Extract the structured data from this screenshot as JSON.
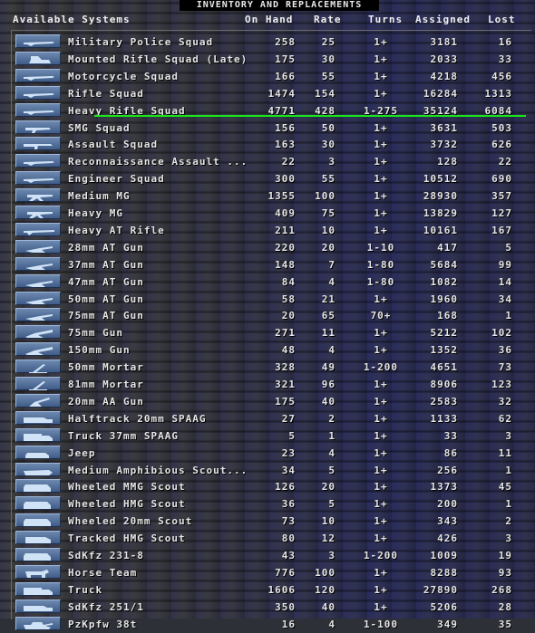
{
  "title": "INVENTORY AND REPLACEMENTS",
  "columns": {
    "name": "Available Systems",
    "on_hand": "On Hand",
    "rate": "Rate",
    "turns": "Turns",
    "assigned": "Assigned",
    "lost": "Lost"
  },
  "accent_colors": {
    "selection_line": "#18e818",
    "button": "#4f6d98"
  },
  "rows": [
    {
      "name": "Military Police Squad",
      "on_hand": "258",
      "rate": "25",
      "turns": "1+",
      "assigned": "3181",
      "lost": "16",
      "icon": "rifle-icon"
    },
    {
      "name": "Mounted Rifle Squad (Late)",
      "on_hand": "175",
      "rate": "30",
      "turns": "1+",
      "assigned": "2033",
      "lost": "33",
      "icon": "mounted-rifle-icon"
    },
    {
      "name": "Motorcycle Squad",
      "on_hand": "166",
      "rate": "55",
      "turns": "1+",
      "assigned": "4218",
      "lost": "456",
      "icon": "rifle-icon"
    },
    {
      "name": "Rifle Squad",
      "on_hand": "1474",
      "rate": "154",
      "turns": "1+",
      "assigned": "16284",
      "lost": "1313",
      "icon": "rifle-icon"
    },
    {
      "name": "Heavy Rifle Squad",
      "on_hand": "4771",
      "rate": "428",
      "turns": "1-275",
      "assigned": "35124",
      "lost": "6084",
      "icon": "rifle-icon"
    },
    {
      "name": "SMG Squad",
      "on_hand": "156",
      "rate": "50",
      "turns": "1+",
      "assigned": "3631",
      "lost": "503",
      "icon": "smg-icon"
    },
    {
      "name": "Assault Squad",
      "on_hand": "163",
      "rate": "30",
      "turns": "1+",
      "assigned": "3732",
      "lost": "626",
      "icon": "assault-rifle-icon"
    },
    {
      "name": "Reconnaissance Assault ...",
      "on_hand": "22",
      "rate": "3",
      "turns": "1+",
      "assigned": "128",
      "lost": "22",
      "icon": "rifle-icon"
    },
    {
      "name": "Engineer Squad",
      "on_hand": "300",
      "rate": "55",
      "turns": "1+",
      "assigned": "10512",
      "lost": "690",
      "icon": "rifle-icon"
    },
    {
      "name": "Medium MG",
      "on_hand": "1355",
      "rate": "100",
      "turns": "1+",
      "assigned": "28930",
      "lost": "357",
      "icon": "machine-gun-icon"
    },
    {
      "name": "Heavy MG",
      "on_hand": "409",
      "rate": "75",
      "turns": "1+",
      "assigned": "13829",
      "lost": "127",
      "icon": "machine-gun-icon"
    },
    {
      "name": "Heavy AT Rifle",
      "on_hand": "211",
      "rate": "10",
      "turns": "1+",
      "assigned": "10161",
      "lost": "167",
      "icon": "at-rifle-icon"
    },
    {
      "name": "28mm AT Gun",
      "on_hand": "220",
      "rate": "20",
      "turns": "1-10",
      "assigned": "417",
      "lost": "5",
      "icon": "at-gun-icon"
    },
    {
      "name": "37mm AT Gun",
      "on_hand": "148",
      "rate": "7",
      "turns": "1-80",
      "assigned": "5684",
      "lost": "99",
      "icon": "at-gun-icon"
    },
    {
      "name": "47mm AT Gun",
      "on_hand": "84",
      "rate": "4",
      "turns": "1-80",
      "assigned": "1082",
      "lost": "14",
      "icon": "at-gun-icon"
    },
    {
      "name": "50mm AT Gun",
      "on_hand": "58",
      "rate": "21",
      "turns": "1+",
      "assigned": "1960",
      "lost": "34",
      "icon": "at-gun-icon"
    },
    {
      "name": "75mm AT Gun",
      "on_hand": "20",
      "rate": "65",
      "turns": "70+",
      "assigned": "168",
      "lost": "1",
      "icon": "at-gun-icon"
    },
    {
      "name": "75mm Gun",
      "on_hand": "271",
      "rate": "11",
      "turns": "1+",
      "assigned": "5212",
      "lost": "102",
      "icon": "field-gun-icon"
    },
    {
      "name": "150mm Gun",
      "on_hand": "48",
      "rate": "4",
      "turns": "1+",
      "assigned": "1352",
      "lost": "36",
      "icon": "field-gun-icon"
    },
    {
      "name": "50mm Mortar",
      "on_hand": "328",
      "rate": "49",
      "turns": "1-200",
      "assigned": "4651",
      "lost": "73",
      "icon": "mortar-icon"
    },
    {
      "name": "81mm Mortar",
      "on_hand": "321",
      "rate": "96",
      "turns": "1+",
      "assigned": "8906",
      "lost": "123",
      "icon": "mortar-icon"
    },
    {
      "name": "20mm AA Gun",
      "on_hand": "175",
      "rate": "40",
      "turns": "1+",
      "assigned": "2583",
      "lost": "32",
      "icon": "aa-gun-icon"
    },
    {
      "name": "Halftrack 20mm SPAAG",
      "on_hand": "27",
      "rate": "2",
      "turns": "1+",
      "assigned": "1133",
      "lost": "62",
      "icon": "halftrack-icon"
    },
    {
      "name": "Truck 37mm SPAAG",
      "on_hand": "5",
      "rate": "1",
      "turns": "1+",
      "assigned": "33",
      "lost": "3",
      "icon": "truck-icon"
    },
    {
      "name": "Jeep",
      "on_hand": "23",
      "rate": "4",
      "turns": "1+",
      "assigned": "86",
      "lost": "11",
      "icon": "jeep-icon"
    },
    {
      "name": "Medium Amphibious Scout...",
      "on_hand": "34",
      "rate": "5",
      "turns": "1+",
      "assigned": "256",
      "lost": "1",
      "icon": "amphibious-icon"
    },
    {
      "name": "Wheeled MMG Scout",
      "on_hand": "126",
      "rate": "20",
      "turns": "1+",
      "assigned": "1373",
      "lost": "45",
      "icon": "armored-car-icon"
    },
    {
      "name": "Wheeled HMG Scout",
      "on_hand": "36",
      "rate": "5",
      "turns": "1+",
      "assigned": "200",
      "lost": "1",
      "icon": "armored-car-icon"
    },
    {
      "name": "Wheeled 20mm Scout",
      "on_hand": "73",
      "rate": "10",
      "turns": "1+",
      "assigned": "343",
      "lost": "2",
      "icon": "armored-car-icon"
    },
    {
      "name": "Tracked HMG Scout",
      "on_hand": "80",
      "rate": "12",
      "turns": "1+",
      "assigned": "426",
      "lost": "3",
      "icon": "tracked-scout-icon"
    },
    {
      "name": "SdKfz 231-8",
      "on_hand": "43",
      "rate": "3",
      "turns": "1-200",
      "assigned": "1009",
      "lost": "19",
      "icon": "armored-car-icon"
    },
    {
      "name": "Horse Team",
      "on_hand": "776",
      "rate": "100",
      "turns": "1+",
      "assigned": "8288",
      "lost": "93",
      "icon": "horse-icon"
    },
    {
      "name": "Truck",
      "on_hand": "1606",
      "rate": "120",
      "turns": "1+",
      "assigned": "27890",
      "lost": "268",
      "icon": "truck-icon"
    },
    {
      "name": "SdKfz 251/1",
      "on_hand": "350",
      "rate": "40",
      "turns": "1+",
      "assigned": "5206",
      "lost": "28",
      "icon": "halftrack-icon"
    },
    {
      "name": "PzKpfw 38t",
      "on_hand": "16",
      "rate": "4",
      "turns": "1-100",
      "assigned": "349",
      "lost": "35",
      "icon": "tank-icon"
    }
  ]
}
